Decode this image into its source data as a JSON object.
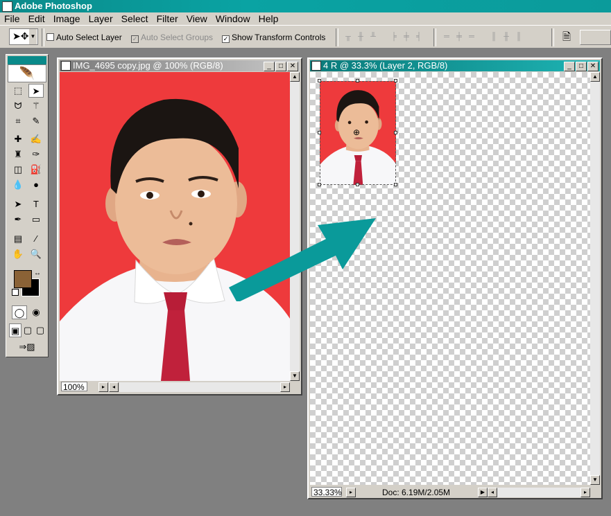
{
  "app": {
    "title": "Adobe Photoshop"
  },
  "menu": [
    "File",
    "Edit",
    "Image",
    "Layer",
    "Select",
    "Filter",
    "View",
    "Window",
    "Help"
  ],
  "options": {
    "auto_select_layer": {
      "label": "Auto Select Layer",
      "checked": false
    },
    "auto_select_groups": {
      "label": "Auto Select Groups",
      "checked": true,
      "enabled": false
    },
    "show_transform_controls": {
      "label": "Show Transform Controls",
      "checked": true
    }
  },
  "colors": {
    "accent": "#0a9a9a",
    "foreground": "#8a6236",
    "background": "#000000",
    "photo_bg": "#ee3a3c",
    "tie": "#c0213b"
  },
  "window1": {
    "title": "IMG_4695 copy.jpg @ 100% (RGB/8)",
    "zoom": "100%"
  },
  "window2": {
    "title": "4 R @ 33.3% (Layer 2, RGB/8)",
    "zoom": "33.33%",
    "doc_info": "Doc: 6.19M/2.05M"
  },
  "window_buttons": {
    "min": "_",
    "max": "□",
    "close": "✕"
  }
}
